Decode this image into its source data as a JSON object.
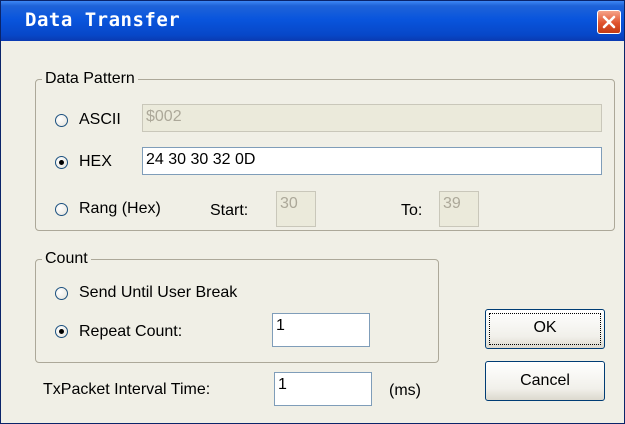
{
  "window": {
    "title": "Data Transfer"
  },
  "data_pattern": {
    "legend": "Data Pattern",
    "ascii": {
      "label": "ASCII",
      "value": "$002",
      "selected": false
    },
    "hex": {
      "label": "HEX",
      "value": "24 30 30 32 0D",
      "selected": true
    },
    "range": {
      "label": "Rang (Hex)",
      "start_label": "Start:",
      "start_value": "30",
      "to_label": "To:",
      "to_value": "39",
      "selected": false
    }
  },
  "count": {
    "legend": "Count",
    "send_until_break": {
      "label": "Send Until User Break",
      "selected": false
    },
    "repeat": {
      "label": "Repeat Count:",
      "value": "1",
      "selected": true
    }
  },
  "interval": {
    "label": "TxPacket Interval Time:",
    "value": "1",
    "unit": "(ms)"
  },
  "buttons": {
    "ok": "OK",
    "cancel": "Cancel"
  },
  "colors": {
    "titlebar": "#0955dd",
    "close_button": "#e0532e",
    "dialog_bg": "#f0efe6"
  }
}
